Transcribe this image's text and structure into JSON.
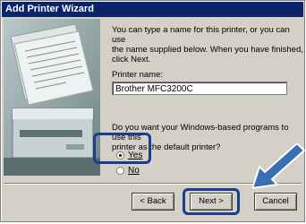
{
  "window": {
    "title": "Add Printer Wizard"
  },
  "intro": {
    "line1": "You can type a name for this printer, or you can use",
    "line2": "the name supplied below. When you have finished,",
    "line3": "click Next."
  },
  "printer_name": {
    "label": "Printer name:",
    "value": "Brother MFC3200C"
  },
  "default_question": {
    "line1": "Do you want your Windows-based programs to use this",
    "line2": "printer as the default printer?"
  },
  "options": {
    "yes": "Yes",
    "no": "No",
    "selected": "Yes"
  },
  "buttons": {
    "back": "< Back",
    "next": "Next >",
    "cancel": "Cancel"
  },
  "colors": {
    "titlebar": "#0a246a",
    "highlight": "#1a3e8c",
    "dialog_bg": "#d4d0c8"
  }
}
